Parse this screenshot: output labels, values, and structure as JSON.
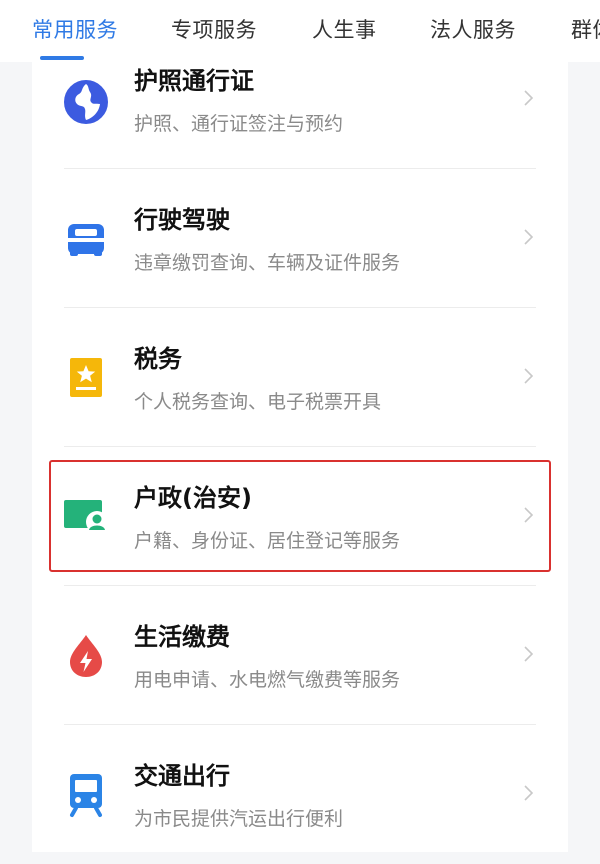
{
  "tabs": [
    {
      "label": "常用服务"
    },
    {
      "label": "专项服务"
    },
    {
      "label": "人生事"
    },
    {
      "label": "法人服务"
    },
    {
      "label": "群体"
    }
  ],
  "services": [
    {
      "title": "护照通行证",
      "subtitle": "护照、通行证签注与预约",
      "icon": "globe-icon",
      "color": "#3c5be0"
    },
    {
      "title": "行驶驾驶",
      "subtitle": "违章缴罚查询、车辆及证件服务",
      "icon": "car-icon",
      "color": "#2f74e8"
    },
    {
      "title": "税务",
      "subtitle": "个人税务查询、电子税票开具",
      "icon": "star-ticket-icon",
      "color": "#f5b70a"
    },
    {
      "title": "户政(治安)",
      "subtitle": "户籍、身份证、居住登记等服务",
      "icon": "id-card-icon",
      "color": "#24b27a"
    },
    {
      "title": "生活缴费",
      "subtitle": "用电申请、水电燃气缴费等服务",
      "icon": "utility-drop-icon",
      "color": "#e64a47"
    },
    {
      "title": "交通出行",
      "subtitle": "为市民提供汽运出行便利",
      "icon": "bus-icon",
      "color": "#2b84e6"
    }
  ],
  "colors": {
    "accent": "#2f7ae5",
    "highlight": "#d9312f"
  }
}
